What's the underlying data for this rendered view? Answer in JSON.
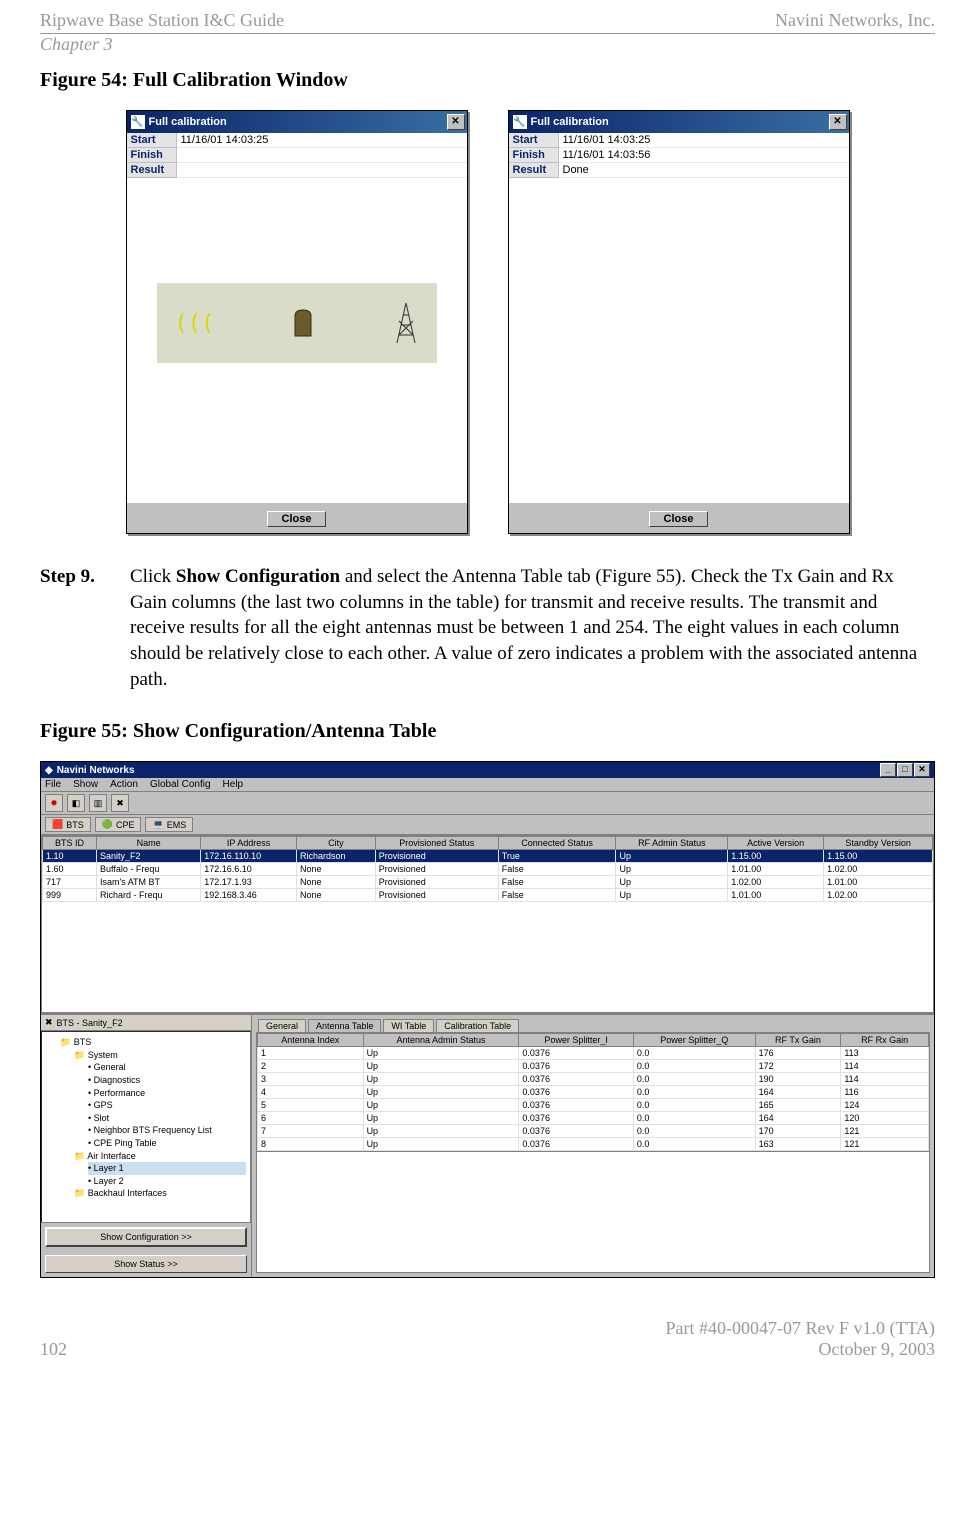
{
  "header": {
    "left": "Ripwave Base Station I&C Guide",
    "right": "Navini Networks, Inc.",
    "chapter": "Chapter 3"
  },
  "figure54_caption": "Figure 54:  Full Calibration Window",
  "cal_win_left": {
    "title": "Full calibration",
    "start_label": "Start",
    "start_val": "11/16/01 14:03:25",
    "finish_label": "Finish",
    "finish_val": "",
    "result_label": "Result",
    "result_val": "",
    "close_label": "Close"
  },
  "cal_win_right": {
    "title": "Full calibration",
    "start_label": "Start",
    "start_val": "11/16/01 14:03:25",
    "finish_label": "Finish",
    "finish_val": "11/16/01 14:03:56",
    "result_label": "Result",
    "result_val": "Done",
    "close_label": "Close"
  },
  "step9": {
    "label": "Step 9.",
    "pre": "Click ",
    "bold": "Show Configuration",
    "post": " and select the Antenna Table tab (Figure 55). Check the Tx Gain and Rx Gain columns (the last two columns in the table) for transmit and receive results. The transmit and receive results for all the eight antennas must be between 1 and 254.  The eight values in each column should be relatively close to each other. A value of zero indicates a problem with the associated antenna path."
  },
  "figure55_caption": "Figure 55:  Show Configuration/Antenna Table",
  "app": {
    "title": "Navini Networks",
    "menu": [
      "File",
      "Show",
      "Action",
      "Global Config",
      "Help"
    ],
    "server_tabs": [
      {
        "icon": "🟥",
        "label": "BTS"
      },
      {
        "icon": "🟢",
        "label": "CPE"
      },
      {
        "icon": "💻",
        "label": "EMS"
      }
    ],
    "upper_columns": [
      "BTS ID",
      "Name",
      "IP Address",
      "City",
      "Provisioned Status",
      "Connected Status",
      "RF Admin Status",
      "Active Version",
      "Standby Version"
    ],
    "upper_rows": [
      {
        "hl": true,
        "cells": [
          "1.10",
          "Sanity_F2",
          "172.16.110.10",
          "Richardson",
          "Provisioned",
          "True",
          "Up",
          "1.15.00",
          "1.15.00"
        ]
      },
      {
        "hl": false,
        "cells": [
          "1.60",
          "Buffalo - Frequ",
          "172.16.6.10",
          "None",
          "Provisioned",
          "False",
          "Up",
          "1.01.00",
          "1.02.00"
        ]
      },
      {
        "hl": false,
        "cells": [
          "717",
          "Isam's ATM BT",
          "172.17.1.93",
          "None",
          "Provisioned",
          "False",
          "Up",
          "1.02.00",
          "1.01.00"
        ]
      },
      {
        "hl": false,
        "cells": [
          "999",
          "Richard - Frequ",
          "192.168.3.46",
          "None",
          "Provisioned",
          "False",
          "Up",
          "1.01.00",
          "1.02.00"
        ]
      }
    ],
    "lower_label_icon": "✖",
    "lower_label": "BTS - Sanity_F2",
    "tree": {
      "root": "BTS",
      "system": "System",
      "system_children": [
        "General",
        "Diagnostics",
        "Performance",
        "GPS",
        "Slot",
        "Neighbor BTS Frequency List",
        "CPE Ping Table"
      ],
      "air": "Air Interface",
      "air_children": [
        "Layer 1",
        "Layer 2"
      ],
      "backhaul": "Backhaul Interfaces"
    },
    "show_config_btn": "Show Configuration >>",
    "show_status_btn": "Show Status >>",
    "tabs": [
      "General",
      "Antenna Table",
      "WI Table",
      "Calibration Table"
    ],
    "active_tab_index": 1,
    "ant_columns": [
      "Antenna Index",
      "Antenna Admin Status",
      "Power Splitter_I",
      "Power Splitter_Q",
      "RF Tx Gain",
      "RF Rx Gain"
    ],
    "ant_rows": [
      [
        "1",
        "Up",
        "0.0376",
        "0.0",
        "176",
        "113"
      ],
      [
        "2",
        "Up",
        "0.0376",
        "0.0",
        "172",
        "114"
      ],
      [
        "3",
        "Up",
        "0.0376",
        "0.0",
        "190",
        "114"
      ],
      [
        "4",
        "Up",
        "0.0376",
        "0.0",
        "164",
        "116"
      ],
      [
        "5",
        "Up",
        "0.0376",
        "0.0",
        "165",
        "124"
      ],
      [
        "6",
        "Up",
        "0.0376",
        "0.0",
        "164",
        "120"
      ],
      [
        "7",
        "Up",
        "0.0376",
        "0.0",
        "170",
        "121"
      ],
      [
        "8",
        "Up",
        "0.0376",
        "0.0",
        "163",
        "121"
      ]
    ]
  },
  "footer": {
    "page": "102",
    "part": "Part #40-00047-07 Rev F v1.0 (TTA)",
    "date": "October 9, 2003"
  },
  "chart_data": [
    {
      "type": "table",
      "title": "BTS list (upper pane)",
      "columns": [
        "BTS ID",
        "Name",
        "IP Address",
        "City",
        "Provisioned Status",
        "Connected Status",
        "RF Admin Status",
        "Active Version",
        "Standby Version"
      ],
      "rows": [
        [
          "1.10",
          "Sanity_F2",
          "172.16.110.10",
          "Richardson",
          "Provisioned",
          "True",
          "Up",
          "1.15.00",
          "1.15.00"
        ],
        [
          "1.60",
          "Buffalo - Frequ",
          "172.16.6.10",
          "None",
          "Provisioned",
          "False",
          "Up",
          "1.01.00",
          "1.02.00"
        ],
        [
          "717",
          "Isam's ATM BT",
          "172.17.1.93",
          "None",
          "Provisioned",
          "False",
          "Up",
          "1.02.00",
          "1.01.00"
        ],
        [
          "999",
          "Richard - Frequ",
          "192.168.3.46",
          "None",
          "Provisioned",
          "False",
          "Up",
          "1.01.00",
          "1.02.00"
        ]
      ]
    },
    {
      "type": "table",
      "title": "Antenna Table",
      "columns": [
        "Antenna Index",
        "Antenna Admin Status",
        "Power Splitter_I",
        "Power Splitter_Q",
        "RF Tx Gain",
        "RF Rx Gain"
      ],
      "rows": [
        [
          "1",
          "Up",
          "0.0376",
          "0.0",
          "176",
          "113"
        ],
        [
          "2",
          "Up",
          "0.0376",
          "0.0",
          "172",
          "114"
        ],
        [
          "3",
          "Up",
          "0.0376",
          "0.0",
          "190",
          "114"
        ],
        [
          "4",
          "Up",
          "0.0376",
          "0.0",
          "164",
          "116"
        ],
        [
          "5",
          "Up",
          "0.0376",
          "0.0",
          "165",
          "124"
        ],
        [
          "6",
          "Up",
          "0.0376",
          "0.0",
          "164",
          "120"
        ],
        [
          "7",
          "Up",
          "0.0376",
          "0.0",
          "170",
          "121"
        ],
        [
          "8",
          "Up",
          "0.0376",
          "0.0",
          "163",
          "121"
        ]
      ]
    }
  ]
}
